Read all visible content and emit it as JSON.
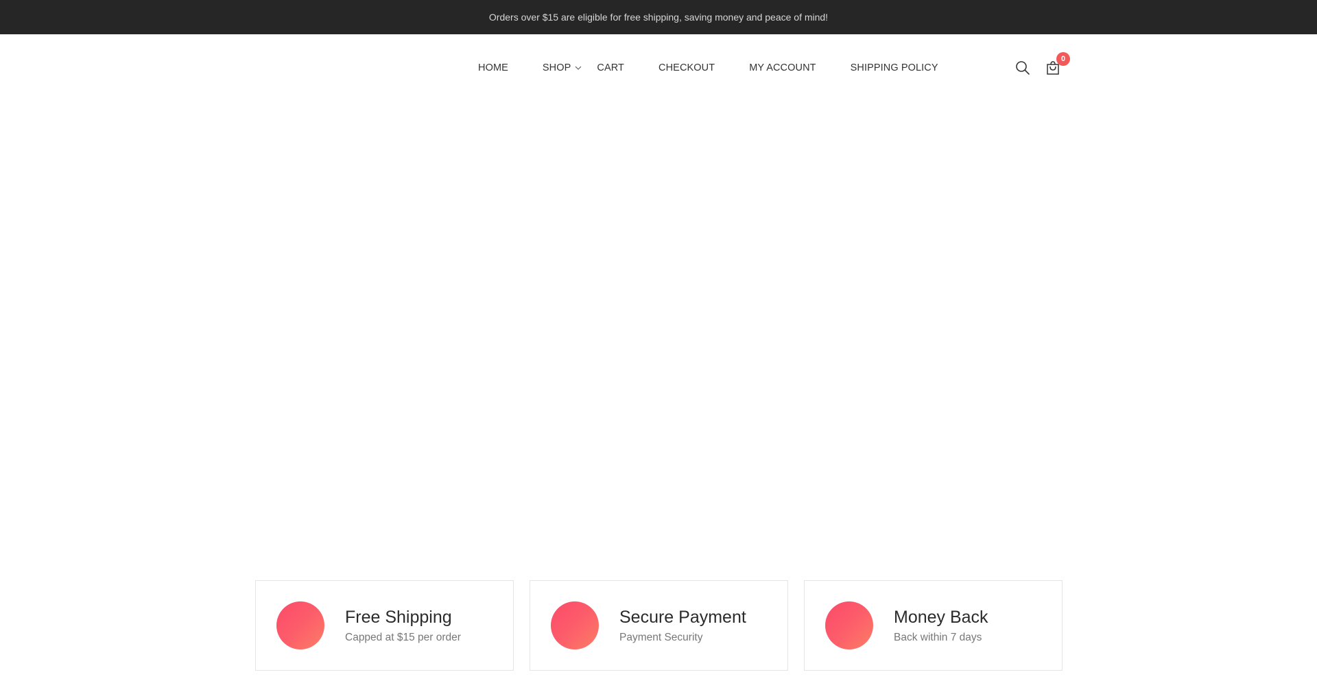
{
  "topbar": {
    "message": "Orders over $15 are eligible for free shipping, saving money and peace of mind!"
  },
  "nav": {
    "items": [
      {
        "label": "HOME"
      },
      {
        "label": "SHOP"
      },
      {
        "label": "CART"
      },
      {
        "label": "CHECKOUT"
      },
      {
        "label": "MY ACCOUNT"
      },
      {
        "label": "SHIPPING POLICY"
      }
    ]
  },
  "header_icons": {
    "search": "search-icon",
    "cart": "shopping-bag-icon",
    "cart_count": "0"
  },
  "features": [
    {
      "title": "Free Shipping",
      "subtitle": "Capped at $15 per order"
    },
    {
      "title": "Secure Payment",
      "subtitle": "Payment Security"
    },
    {
      "title": "Money Back",
      "subtitle": "Back within 7 days"
    }
  ],
  "colors": {
    "topbar_bg": "#262626",
    "accent": "#f25a5a",
    "feature_gradient_start": "#fb4a6a",
    "feature_gradient_end": "#fd7e66"
  }
}
